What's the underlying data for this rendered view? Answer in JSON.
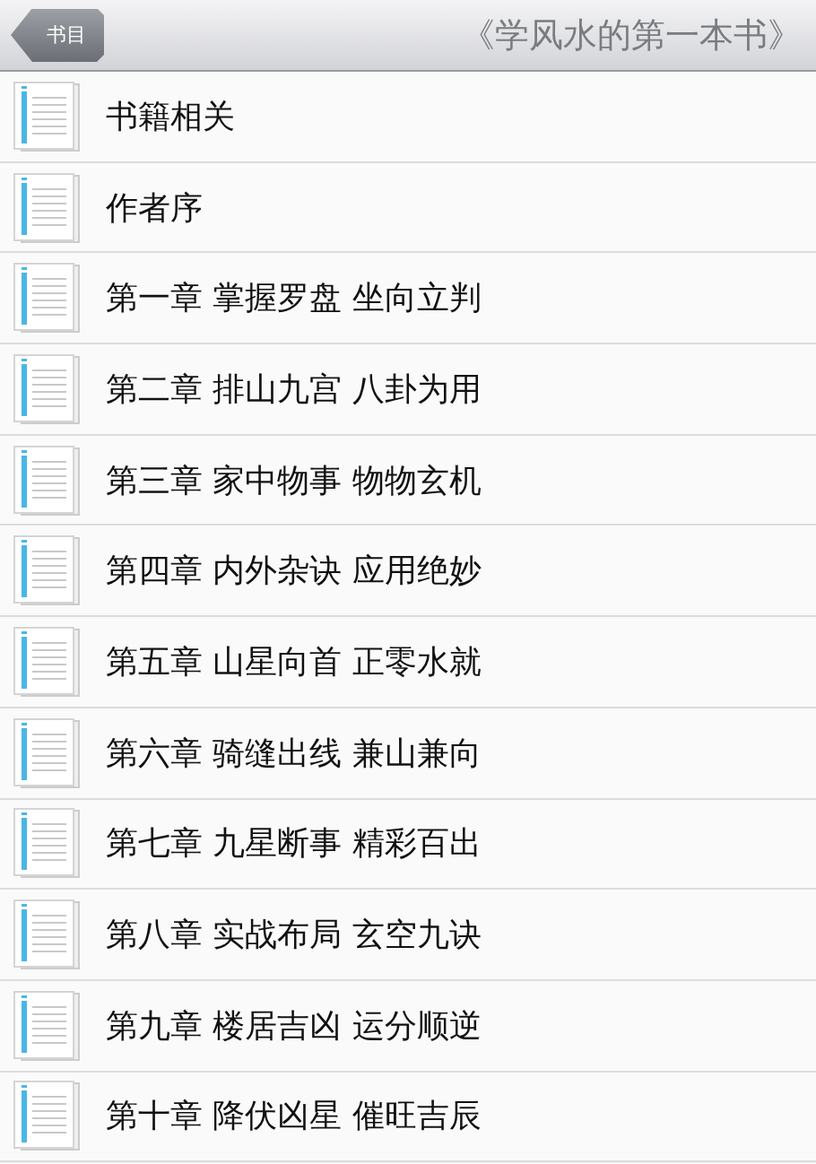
{
  "nav_bar": {
    "back_button": "书目",
    "title": "《学风水的第一本书》"
  },
  "chapters": [
    {
      "title": "书籍相关"
    },
    {
      "title": "作者序"
    },
    {
      "title": "第一章 掌握罗盘 坐向立判"
    },
    {
      "title": "第二章 排山九宫 八卦为用"
    },
    {
      "title": "第三章 家中物事 物物玄机"
    },
    {
      "title": "第四章 内外杂诀 应用绝妙"
    },
    {
      "title": "第五章 山星向首 正零水就"
    },
    {
      "title": "第六章 骑缝出线 兼山兼向"
    },
    {
      "title": "第七章 九星断事 精彩百出"
    },
    {
      "title": "第八章 实战布局 玄空九诀"
    },
    {
      "title": "第九章 楼居吉凶 运分顺逆"
    },
    {
      "title": "第十章 降伏凶星 催旺吉辰"
    }
  ]
}
